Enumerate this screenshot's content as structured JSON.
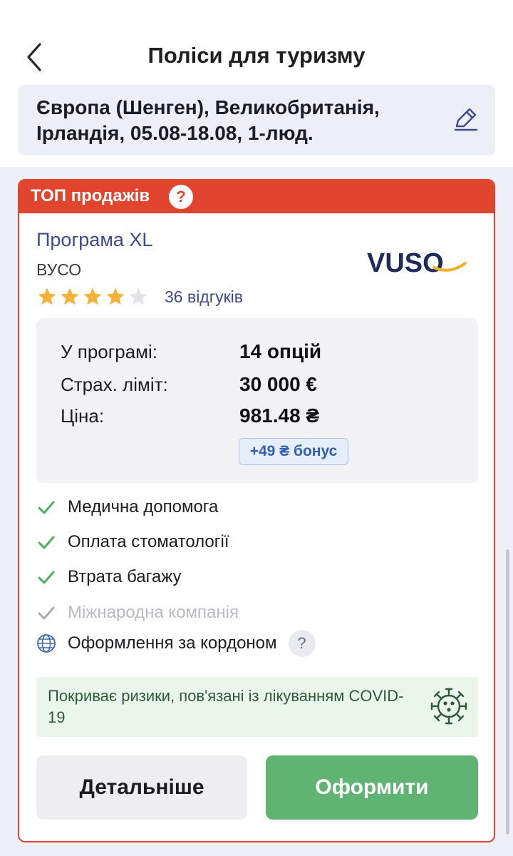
{
  "header": {
    "title": "Поліси для туризму",
    "search_summary": "Європа (Шенген), Великобританія, Ірландія, 05.08-18.08, 1-люд."
  },
  "offer": {
    "badge": "ТОП продажів",
    "badge_help": "?",
    "program_name": "Програма XL",
    "insurer_name": "ВУСО",
    "logo_text": "VUSO",
    "rating_stars": 4,
    "rating_max": 5,
    "reviews_label": "36 відгуків",
    "details": {
      "options_label": "У програмі:",
      "options_value": "14 опцій",
      "limit_label": "Страх. ліміт:",
      "limit_value": "30 000 €",
      "price_label": "Ціна:",
      "price_value": "981.48 ₴",
      "bonus": "+49 ₴ бонус"
    },
    "features": [
      {
        "label": "Медична допомога",
        "enabled": true
      },
      {
        "label": "Оплата стоматології",
        "enabled": true
      },
      {
        "label": "Втрата багажу",
        "enabled": true
      },
      {
        "label": "Міжнародна компанія",
        "enabled": false
      }
    ],
    "abroad_feature": "Оформлення за кордоном",
    "abroad_help": "?",
    "covid_note": "Покриває ризики, пов'язані із лікуванням COVID-19",
    "buttons": {
      "more": "Детальніше",
      "buy": "Оформити"
    }
  },
  "colors": {
    "accent_red": "#e2452e",
    "link_blue": "#3e4a8c",
    "star_gold": "#f4b23a",
    "check_green": "#4caf62",
    "buy_green": "#5fb473"
  }
}
